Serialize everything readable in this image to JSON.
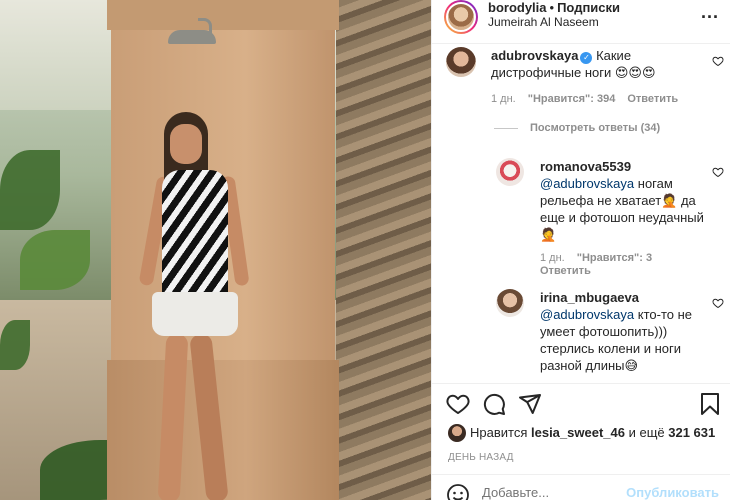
{
  "post": {
    "username": "borodylia",
    "separator": "•",
    "follow_label": "Подписки",
    "location": "Jumeirah Al Naseem",
    "more_label": "..."
  },
  "comments": [
    {
      "username": "adubrovskaya",
      "verified": true,
      "text": "Какие дистрофичные ноги 😍😍😍",
      "time": "1 дн.",
      "likes": "\"Нравится\": 394",
      "reply_label": "Ответить"
    }
  ],
  "view_replies": "Посмотреть ответы (34)",
  "replies": [
    {
      "username": "romanova5539",
      "mention": "@adubrovskaya",
      "text": "ногам рельефа не хватает🤦 да еще и фотошоп неудачный🤦",
      "time": "1 дн.",
      "likes": "\"Нравится\": 3",
      "reply_label": "Ответить"
    },
    {
      "username": "irina_mbugaeva",
      "mention": "@adubrovskaya",
      "text": "кто-то не умеет фотошопить))) стерлись колени и ноги разной длины😅"
    }
  ],
  "footer": {
    "likes_prefix": "Нравится",
    "likes_user": "lesia_sweet_46",
    "likes_and": "и ещё",
    "likes_count": "321 631",
    "time_ago": "ДЕНЬ НАЗАД",
    "add_comment_placeholder": "Добавьте...",
    "publish_label": "Опубликовать"
  },
  "icons": {
    "heart": "heart-icon",
    "comment": "comment-icon",
    "share": "share-icon",
    "save": "bookmark-icon",
    "emoji": "emoji-icon"
  },
  "colors": {
    "text": "#262626",
    "muted": "#8e8e8e",
    "mention": "#00376b",
    "verified": "#3897f0",
    "publish_disabled": "#b2dffc"
  }
}
